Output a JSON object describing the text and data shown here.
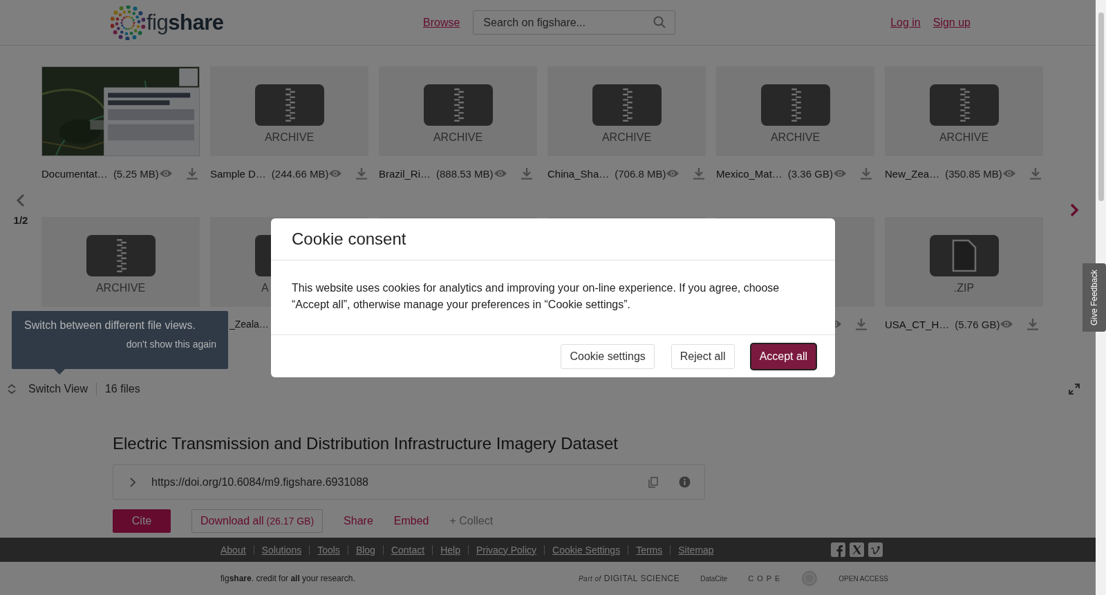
{
  "header": {
    "logo": "fig**share**",
    "nav_link": "Browse",
    "search": {
      "placeholder": "Search on figshare..."
    },
    "links": [
      "Log in",
      "Sign up"
    ]
  },
  "viewer": {
    "pager": "1/2",
    "files": [
      {
        "name": "Documentat…",
        "size": "(5.25 MB)"
      },
      {
        "kind": "archive",
        "label": "ARCHIVE",
        "name": "Sample D…",
        "size": "(244.66 MB)"
      },
      {
        "kind": "archive",
        "label": "ARCHIVE",
        "name": "Brazil_Ri…",
        "size": "(888.53 MB)"
      },
      {
        "kind": "archive",
        "label": "ARCHIVE",
        "name": "China_Sha…",
        "size": "(706.8 MB)"
      },
      {
        "kind": "archive",
        "label": "ARCHIVE",
        "name": "Mexico_Mat…",
        "size": "(3.36 GB)"
      },
      {
        "kind": "archive",
        "label": "ARCHIVE",
        "name": "New_Zea…",
        "size": "(350.85 MB)"
      },
      {
        "kind": "archive",
        "label": "ARCHIVE"
      },
      {
        "kind": "archive_cut",
        "label": "A",
        "name": "_Zeala…"
      },
      {
        "kind": "blank"
      },
      {
        "kind": "blank"
      },
      {
        "kind": "covered"
      },
      {
        "kind": "document",
        "label": ".ZIP",
        "name": "USA_CT_H…",
        "size": "(5.76 GB)"
      }
    ],
    "switch_view": "Switch View",
    "file_count": "16 files",
    "tooltip": {
      "text": "Switch between different file views.",
      "dismiss": "don't show this again"
    }
  },
  "dataset": {
    "title": "Electric Transmission and Distribution Infrastructure Imagery Dataset",
    "doi": "https://doi.org/10.6084/m9.figshare.6931088",
    "actions": [
      {
        "kind": "primary",
        "label": "Cite"
      },
      {
        "kind": "outline",
        "label": "Download all",
        "size": "(26.17 GB)"
      },
      {
        "kind": "link",
        "label": "Share"
      },
      {
        "kind": "link",
        "label": "Embed"
      },
      {
        "kind": "muted",
        "label": "+ Collect"
      }
    ]
  },
  "footer": {
    "links": [
      "About",
      "Solutions",
      "Tools",
      "Blog",
      "Contact",
      "Help",
      "Privacy Policy",
      "Cookie Settings",
      "Terms",
      "Sitemap"
    ],
    "tagline": "fig**share**. credit for **all** your research.",
    "partners": [
      {
        "kind": "digital-science",
        "prefix": "Part of",
        "text": "DIGITAL SCIENCE"
      },
      {
        "kind": "datacite",
        "text": "DataCite"
      },
      {
        "kind": "cope",
        "text": "C O P E"
      },
      {
        "kind": "seal"
      },
      {
        "kind": "open-access",
        "text": "OPEN ACCESS"
      }
    ]
  },
  "feedback_tab": "Give Feedback",
  "cookie_modal": {
    "title": "Cookie consent",
    "body": "This website uses cookies for analytics and improving your on-line experience. If you agree, choose “Accept all”, otherwise manage your preferences in “Cookie settings”.",
    "buttons": [
      {
        "kind": "secondary",
        "label": "Cookie settings"
      },
      {
        "kind": "secondary",
        "label": "Reject all"
      },
      {
        "kind": "primary",
        "label": "Accept all"
      }
    ]
  }
}
